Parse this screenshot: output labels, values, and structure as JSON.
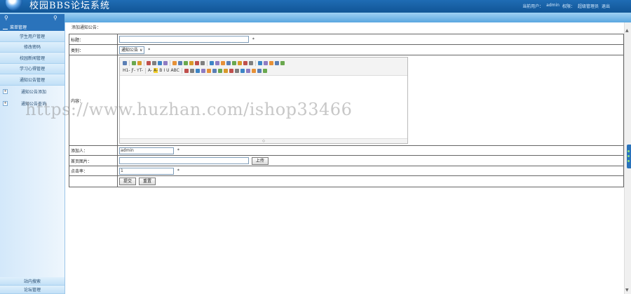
{
  "header": {
    "title": "校园BBS论坛系统",
    "nav": [
      "当前用户：",
      "admin",
      "权限：",
      "超级管理员",
      "退出"
    ]
  },
  "sidebar": {
    "head": "菜单管理",
    "items": [
      "学生用户管理",
      "修改密码",
      "校园新闻管理",
      "学习心得管理",
      "通知公告管理"
    ],
    "folders": [
      "通知公告添加",
      "通知公告查询"
    ],
    "bottom": [
      "站内搜索",
      "论坛管理"
    ]
  },
  "page": {
    "breadcrumb": "添加通知公告：",
    "form": {
      "title_label": "标题：",
      "title_value": "",
      "required_mark": "*",
      "category_label": "类别：",
      "category_value": "通知公告",
      "content_label": "内容：",
      "adder_label": "添加人：",
      "adder_value": "admin",
      "image_label": "首页图片：",
      "image_value": "",
      "upload_label": "上传",
      "clicks_label": "点击率：",
      "clicks_value": "1",
      "submit_label": "提交",
      "reset_label": "重置"
    },
    "editor": {
      "toolbar_row1": [
        "source",
        "undo",
        "redo",
        "preview",
        "print",
        "template",
        "code",
        "cut",
        "copy",
        "paste",
        "plainpaste",
        "wordpaste",
        "selectall",
        "justifyleft",
        "justifycenter",
        "justifyright",
        "justifyfull",
        "insertorderedlist",
        "insertunorderedlist",
        "indent",
        "outdent",
        "subscript",
        "superscript",
        "clearhtml",
        "quickformat",
        "fullscreen"
      ],
      "toolbar_row2_text": [
        "H1-",
        "Ƒ-",
        "тT-",
        "A-",
        "A-",
        "B",
        "I",
        "U",
        "ABC"
      ],
      "toolbar_row2_icons": [
        "hr",
        "removeformat",
        "image",
        "multiimage",
        "flash",
        "media",
        "insertfile",
        "table",
        "emoticons",
        "baidumap",
        "pagebreak",
        "anchor",
        "link",
        "unlink",
        "about"
      ]
    },
    "colors": {
      "accent": "#1f6cb4",
      "sidebar": "#d3e8fa"
    }
  },
  "watermark": "https://www.huzhan.com/ishop33466"
}
